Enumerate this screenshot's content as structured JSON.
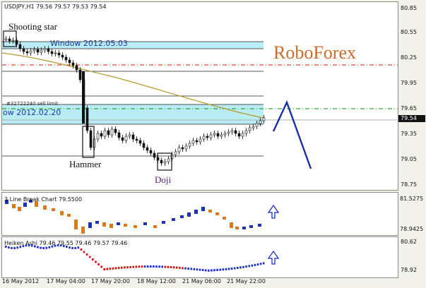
{
  "header": {
    "symbol_line": "USDJPY,H1  79.56 79.57 79.53 79.54"
  },
  "watermark": "RoboForex",
  "annotations": {
    "shooting_star": "Shooting star",
    "hammer": "Hammer",
    "doji": "Doji",
    "window_top": "Window 2012.05.03",
    "window_bottom": "ow 2012.02.20",
    "sell_limit": "#32722240 sell limit"
  },
  "price_axis": [
    "80.85",
    "80.55",
    "80.25",
    "79.95",
    "79.65",
    "79.35",
    "79.05",
    "78.75"
  ],
  "current_price": "79.54",
  "indicator1": {
    "title": "3 Line Break Chart 79.5500",
    "axis": [
      "81.5275",
      "78.9425"
    ]
  },
  "indicator2": {
    "title": "Heiken Ashi 79.46 79.55 79.46 79.57 79.46",
    "axis": [
      "80.62",
      "78.92"
    ]
  },
  "time_axis": [
    "16 May 2012",
    "17 May 04:00",
    "17 May 20:00",
    "18 May 12:00",
    "21 May 06:00",
    "21 May 22:00"
  ],
  "colors": {
    "window_zone": "#b9ecf5",
    "ma_line": "#b49a2a",
    "level_red": "#cc2200",
    "level_green": "#009900",
    "arrow": "#1a2ea8",
    "up": "#1a2ec8",
    "down": "#e07a00",
    "ha_down": "#dd1010"
  }
}
